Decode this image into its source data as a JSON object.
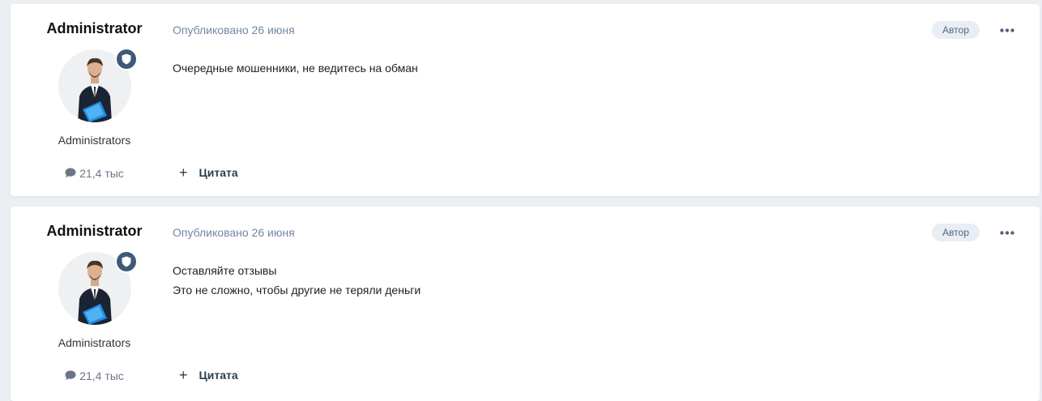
{
  "posts": [
    {
      "author": "Administrator",
      "group": "Administrators",
      "reputation": "21,4 тыс",
      "published": "Опубликовано 26 июня",
      "role_badge": "Автор",
      "lines": [
        "Очередные мошенники, не ведитесь на обман"
      ],
      "quote_label": "Цитата",
      "plus": "+"
    },
    {
      "author": "Administrator",
      "group": "Administrators",
      "reputation": "21,4 тыс",
      "published": "Опубликовано 26 июня",
      "role_badge": "Автор",
      "lines": [
        "Оставляйте отзывы",
        "Это не сложно, чтобы другие не теряли деньги"
      ],
      "quote_label": "Цитата",
      "plus": "+"
    }
  ],
  "icons": {
    "badge": "shield-icon",
    "reputation": "chat-bubble-icon",
    "menu": "more-horizontal-icon"
  },
  "colors": {
    "page_bg": "#ebeef2",
    "meta_text": "#7187a3",
    "badge_bg": "#3e5a78",
    "role_badge_bg": "#e9eef4"
  }
}
